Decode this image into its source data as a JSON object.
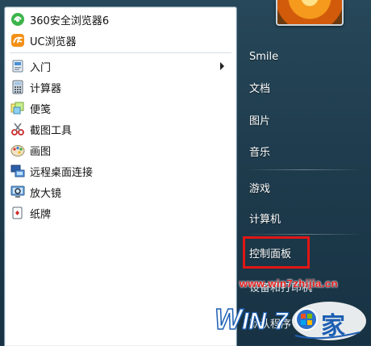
{
  "left_menu": {
    "pinned": [
      {
        "label": "360安全浏览器6",
        "icon": "360-browser-icon"
      },
      {
        "label": "UC浏览器",
        "icon": "uc-browser-icon"
      }
    ],
    "items": [
      {
        "label": "入门",
        "icon": "getting-started-icon",
        "submenu": true
      },
      {
        "label": "计算器",
        "icon": "calculator-icon"
      },
      {
        "label": "便笺",
        "icon": "sticky-notes-icon"
      },
      {
        "label": "截图工具",
        "icon": "snipping-tool-icon"
      },
      {
        "label": "画图",
        "icon": "paint-icon"
      },
      {
        "label": "远程桌面连接",
        "icon": "remote-desktop-icon"
      },
      {
        "label": "放大镜",
        "icon": "magnifier-icon"
      },
      {
        "label": "纸牌",
        "icon": "solitaire-icon"
      }
    ]
  },
  "right_menu": {
    "user_name": "Smile",
    "items": [
      {
        "label": "文档"
      },
      {
        "label": "图片"
      },
      {
        "label": "音乐"
      },
      {
        "label": "游戏"
      },
      {
        "label": "计算机"
      },
      {
        "label": "控制面板",
        "highlighted": true
      },
      {
        "label": "设备和打印机"
      },
      {
        "label": "默认程序"
      }
    ]
  },
  "watermark": {
    "url": "www.win7zhijia.cn",
    "brand": "WIN7",
    "brand_suffix": "家"
  },
  "colors": {
    "highlight_box": "#e01616",
    "watermark_red": "#e52020",
    "menu_bg": "#1f3d4e"
  }
}
